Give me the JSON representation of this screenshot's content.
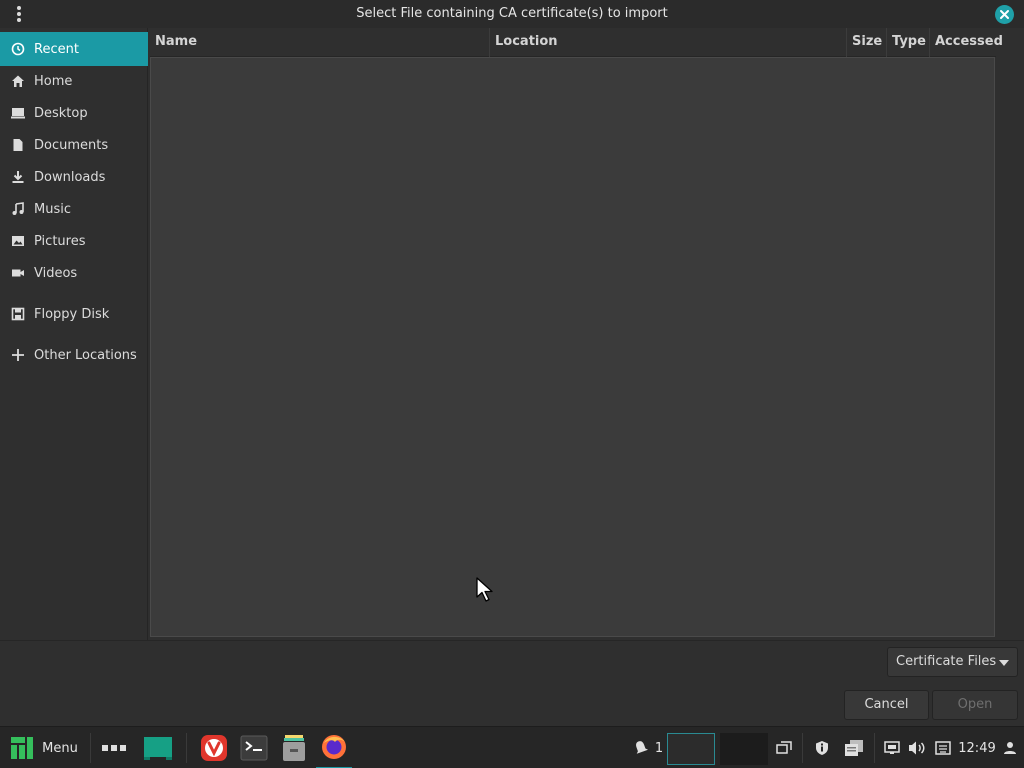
{
  "window": {
    "title": "Select File containing CA certificate(s) to import"
  },
  "sidebar": {
    "items": [
      {
        "label": "Recent",
        "icon": "clock-icon",
        "active": true
      },
      {
        "label": "Home",
        "icon": "home-icon"
      },
      {
        "label": "Desktop",
        "icon": "desktop-icon"
      },
      {
        "label": "Documents",
        "icon": "document-icon"
      },
      {
        "label": "Downloads",
        "icon": "download-icon"
      },
      {
        "label": "Music",
        "icon": "music-icon"
      },
      {
        "label": "Pictures",
        "icon": "picture-icon"
      },
      {
        "label": "Videos",
        "icon": "video-icon"
      },
      {
        "label": "Floppy Disk",
        "icon": "floppy-icon"
      },
      {
        "label": "Other Locations",
        "icon": "plus-icon"
      }
    ]
  },
  "filelist": {
    "columns": [
      "Name",
      "Location",
      "Size",
      "Type",
      "Accessed"
    ]
  },
  "footer": {
    "filter_label": "Certificate Files",
    "cancel_label": "Cancel",
    "open_label": "Open"
  },
  "taskbar": {
    "menu_label": "Menu",
    "notification_count": "1",
    "clock": "12:49"
  },
  "colors": {
    "accent": "#1b9aa5",
    "background": "#2f2f2f",
    "list_background": "#3b3b3b"
  }
}
